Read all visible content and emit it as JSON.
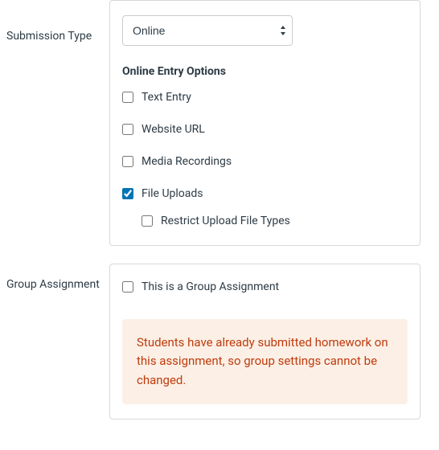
{
  "submission": {
    "label": "Submission Type",
    "selected": "Online",
    "entry_heading": "Online Entry Options",
    "options": {
      "text_entry": {
        "label": "Text Entry",
        "checked": false
      },
      "website_url": {
        "label": "Website URL",
        "checked": false
      },
      "media_recordings": {
        "label": "Media Recordings",
        "checked": false
      },
      "file_uploads": {
        "label": "File Uploads",
        "checked": true
      },
      "restrict_upload": {
        "label": "Restrict Upload File Types",
        "checked": false
      }
    }
  },
  "group": {
    "label": "Group Assignment",
    "checkbox": {
      "label": "This is a Group Assignment",
      "checked": false
    },
    "alert": "Students have already submitted homework on this assignment, so group settings cannot be changed."
  }
}
